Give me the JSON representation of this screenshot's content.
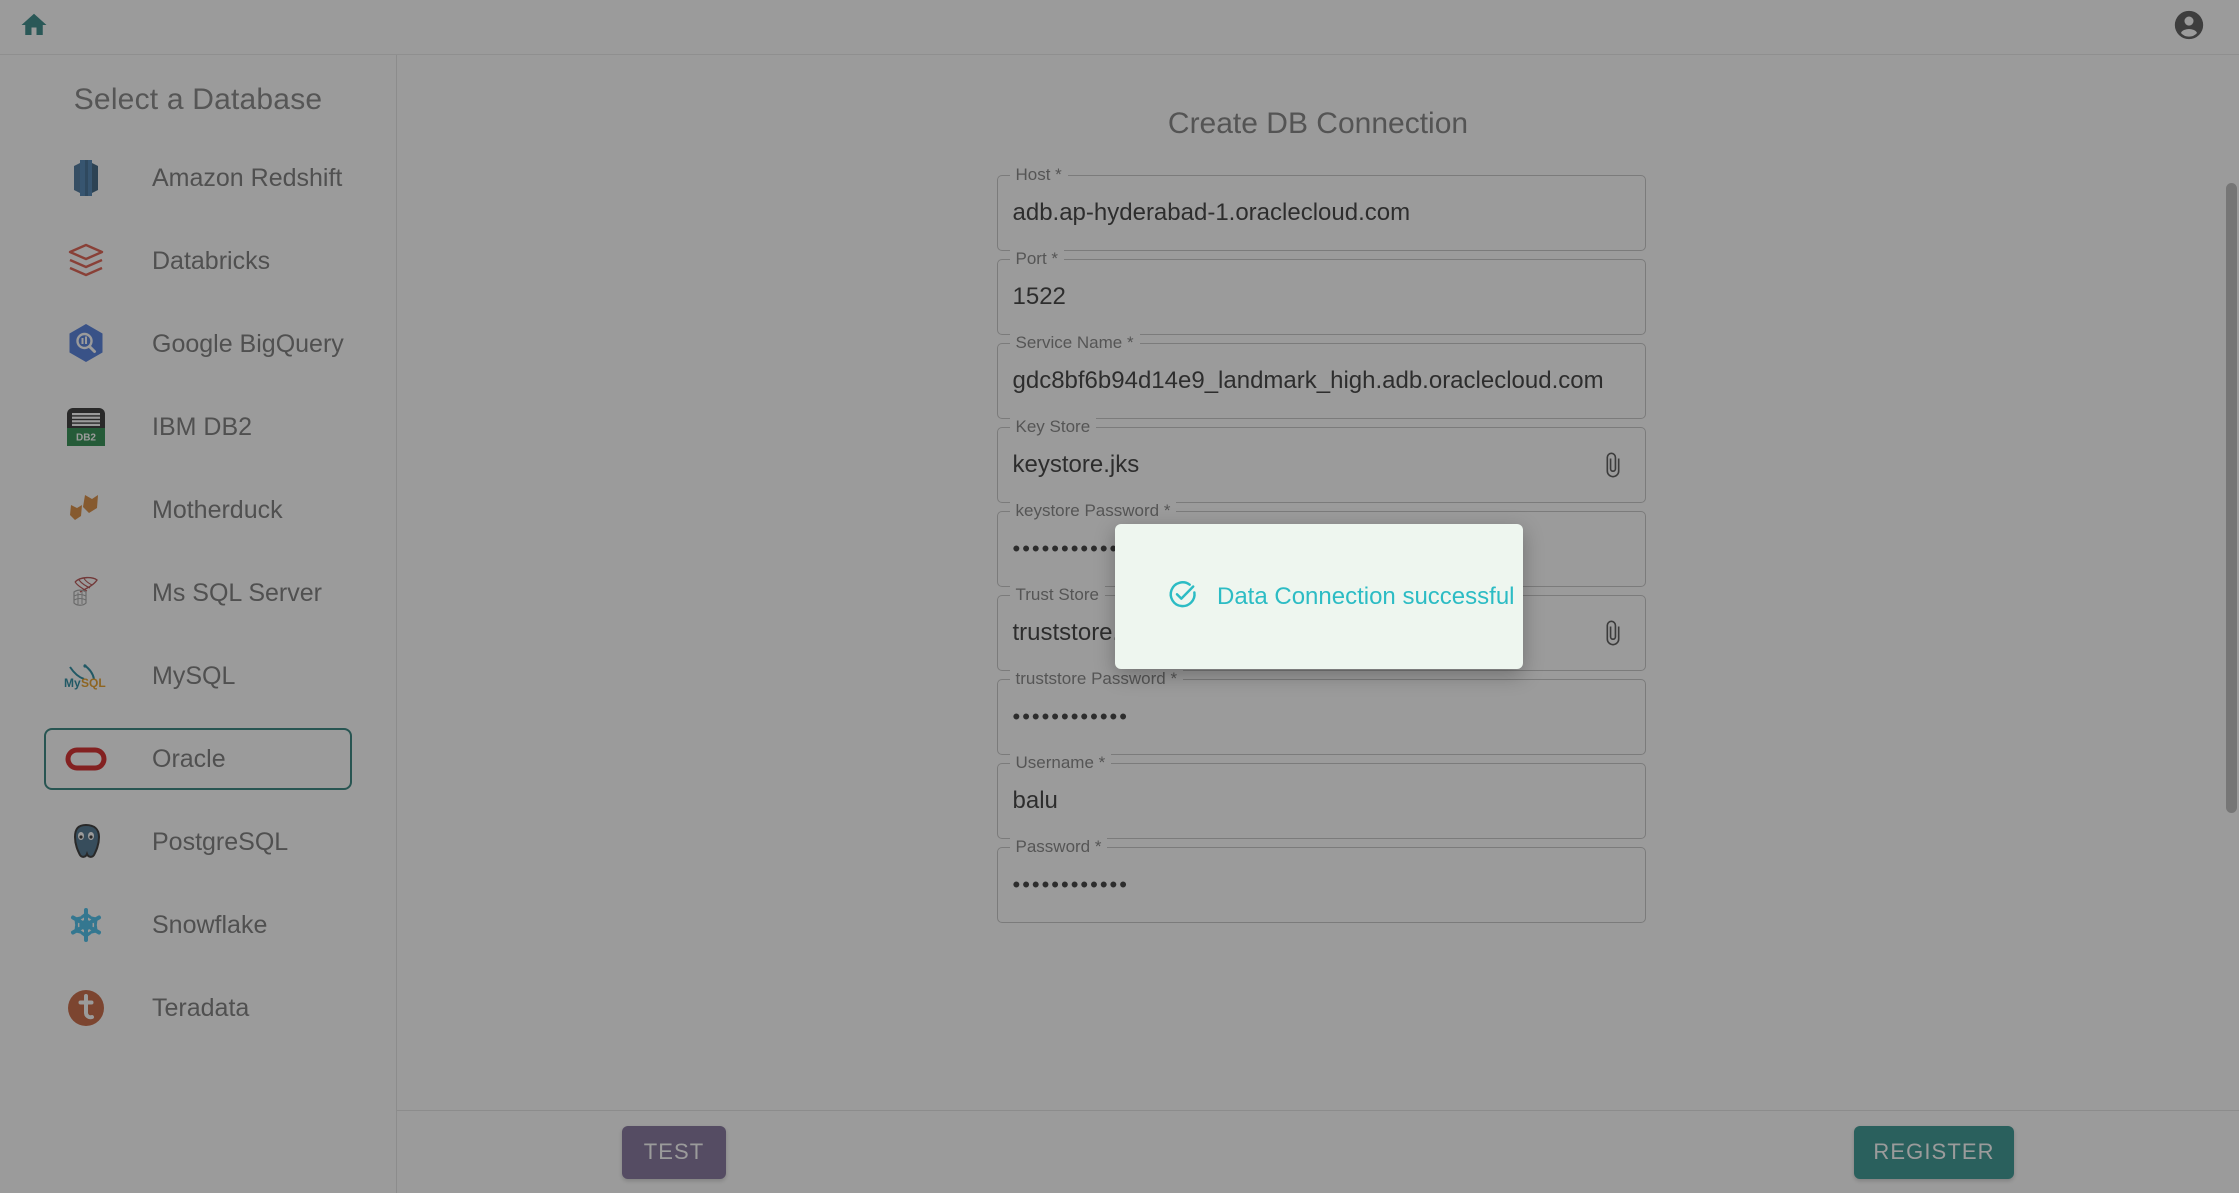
{
  "appbar": {
    "home_icon": "home-icon",
    "account_icon": "account-circle-icon"
  },
  "sidebar": {
    "title": "Select a Database",
    "selected": "Oracle",
    "items": [
      {
        "label": "Amazon Redshift",
        "icon": "amazon-redshift-icon"
      },
      {
        "label": "Databricks",
        "icon": "databricks-icon"
      },
      {
        "label": "Google BigQuery",
        "icon": "google-bigquery-icon"
      },
      {
        "label": "IBM DB2",
        "icon": "ibm-db2-icon"
      },
      {
        "label": "Motherduck",
        "icon": "motherduck-icon"
      },
      {
        "label": "Ms SQL Server",
        "icon": "ms-sql-server-icon"
      },
      {
        "label": "MySQL",
        "icon": "mysql-icon"
      },
      {
        "label": "Oracle",
        "icon": "oracle-icon"
      },
      {
        "label": "PostgreSQL",
        "icon": "postgresql-icon"
      },
      {
        "label": "Snowflake",
        "icon": "snowflake-icon"
      },
      {
        "label": "Teradata",
        "icon": "teradata-icon"
      }
    ]
  },
  "form": {
    "title": "Create DB Connection",
    "fields": [
      {
        "label": "Host *",
        "value": "adb.ap-hyderabad-1.oraclecloud.com",
        "type": "text",
        "attach": false
      },
      {
        "label": "Port *",
        "value": "1522",
        "type": "text",
        "attach": false
      },
      {
        "label": "Service Name *",
        "value": "gdc8bf6b94d14e9_landmark_high.adb.oraclecloud.com",
        "type": "text",
        "attach": false
      },
      {
        "label": "Key Store",
        "value": "keystore.jks",
        "type": "file",
        "attach": true
      },
      {
        "label": "keystore Password *",
        "value": "••••••••••••",
        "type": "password",
        "attach": false
      },
      {
        "label": "Trust Store",
        "value": "truststore.jks",
        "type": "file",
        "attach": true
      },
      {
        "label": "truststore Password *",
        "value": "••••••••••••",
        "type": "password",
        "attach": false
      },
      {
        "label": "Username *",
        "value": "balu",
        "type": "text",
        "attach": false
      },
      {
        "label": "Password *",
        "value": "••••••••••••",
        "type": "password",
        "attach": false
      }
    ]
  },
  "actions": {
    "test_label": "TEST",
    "register_label": "REGISTER",
    "test_color": "#6d5b8a",
    "register_color": "#14857e"
  },
  "toast": {
    "message": "Data Connection successful",
    "icon": "check-circle-icon",
    "text_color": "#2cbcc4",
    "background": "#eef6ef"
  }
}
